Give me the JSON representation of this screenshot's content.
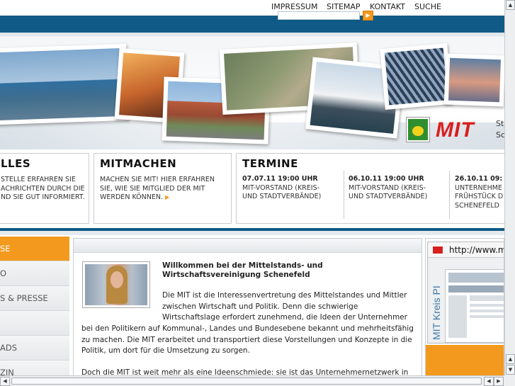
{
  "topnav": {
    "items": [
      "IMPRESSUM",
      "SITEMAP",
      "KONTAKT",
      "SUCHE"
    ]
  },
  "search": {
    "placeholder": "",
    "go_icon": "arrow-right-icon"
  },
  "banner": {
    "logo_text": "MIT",
    "logo_side_line1": "St",
    "logo_side_line2": "Sc",
    "colors": {
      "logo_red": "#d81f1f",
      "crest_green": "#2f8f2f",
      "crest_yellow": "#f3d21c"
    }
  },
  "boxes": {
    "aktuelles": {
      "title": "LLES",
      "text_line1": "STELLE ERFAHREN SIE",
      "text_line2": "ACHRICHTEN DURCH DIE",
      "text_line3": "ND SIE GUT INFORMIERT."
    },
    "mitmachen": {
      "title": "MITMACHEN",
      "text_line1": "MACHEN SIE MIT! HIER ERFAHREN",
      "text_line2": "SIE, WIE SIE MITGLIED DER MIT",
      "text_line3": "WERDEN KÖNNEN."
    },
    "termine": {
      "title": "TERMINE",
      "items": [
        {
          "date": "07.07.11 19:00 UHR",
          "line1": "MIT-VORSTAND (KREIS-",
          "line2": "UND STADTVERBÄNDE)",
          "line3": ""
        },
        {
          "date": "06.10.11 19:00 UHR",
          "line1": "MIT-VORSTAND (KREIS-",
          "line2": "UND STADTVERBÄNDE)",
          "line3": ""
        },
        {
          "date": "26.10.11 09:",
          "line1": "UNTERNEHME",
          "line2": "FRÜHSTÜCK D",
          "line3": "SCHENEFELD"
        }
      ]
    }
  },
  "leftnav": {
    "items": [
      "SE",
      "O",
      "S & PRESSE",
      "",
      "ADS",
      "ZIN"
    ],
    "active_index": 0
  },
  "content": {
    "welcome_line1": "Willkommen bei der Mittelstands- und",
    "welcome_line2": "Wirtschaftsvereinigung Schenefeld",
    "para1": [
      "Die MIT ist die Interessenvertretung des Mittelstandes und Mittler",
      "zwischen Wirtschaft und Politik. Denn die schwierige",
      "Wirtschaftslage erfordert zunehmend, die Ideen der Unternehmer",
      "bei den Politikern auf Kommunal-, Landes und Bundesebene bekannt und mehrheitsfähig",
      "zu machen. Die MIT erarbeitet und transportiert diese Vorstellungen und Konzepte in die",
      "Politik, um dort für die Umsetzung zu sorgen."
    ],
    "para2": "Doch die MIT ist weit mehr als eine Ideenschmiede: sie ist das Unternehmernetzwerk in"
  },
  "rightcol": {
    "url_text": "http://www.mi",
    "vertical_text": "MIT Kreis PI"
  },
  "scrollbars": {
    "up_icon": "arrow-up-icon",
    "down_icon": "arrow-down-icon",
    "left_icon": "arrow-left-icon",
    "right_icon": "arrow-right-icon",
    "up_glyph": "▲",
    "down_glyph": "▼",
    "left_glyph": "◀",
    "right_glyph": "▶"
  }
}
